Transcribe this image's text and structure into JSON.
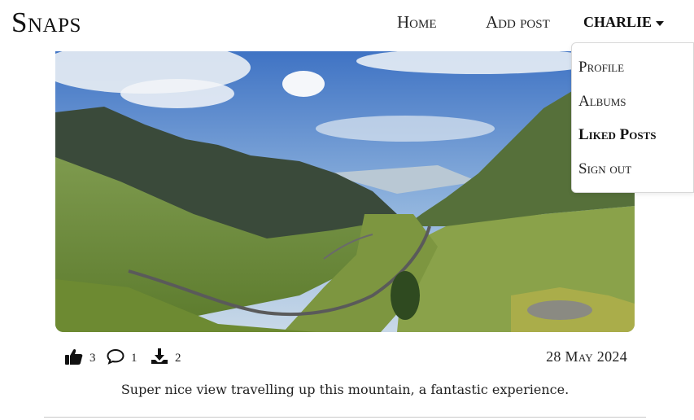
{
  "navbar": {
    "brand": "Snaps",
    "links": [
      {
        "label": "Home"
      },
      {
        "label": "Add post"
      }
    ],
    "user_menu": {
      "label": "CHARLIE",
      "items": [
        {
          "label": "Profile"
        },
        {
          "label": "Albums"
        },
        {
          "label": "Liked Posts"
        },
        {
          "label": "Sign out"
        }
      ]
    }
  },
  "post": {
    "image_alt": "Mountain road winding through green valley",
    "stats": {
      "likes": "3",
      "comments": "1",
      "downloads": "2"
    },
    "date": "28 May 2024",
    "caption": "Super nice view travelling up this mountain, a fantastic experience."
  },
  "icons": {
    "like": "thumbs-up-icon",
    "comment": "comment-icon",
    "download": "download-icon"
  }
}
